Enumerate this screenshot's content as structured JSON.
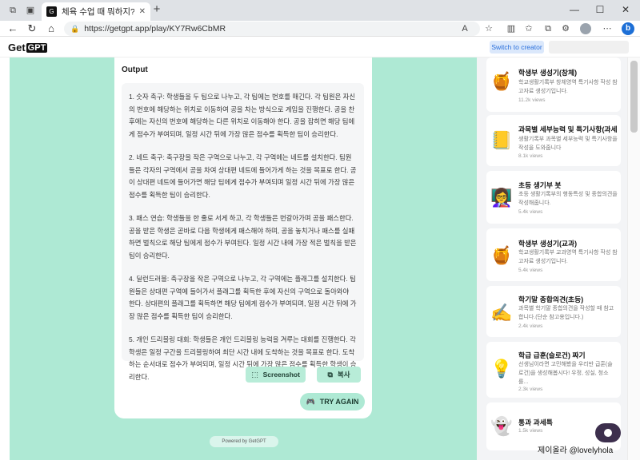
{
  "browser": {
    "tab_title": "체육 수업 때 뭐하지? GetGPT",
    "url": "https://getgpt.app/play/KY7Rw6CbMR"
  },
  "site": {
    "logo_get": "Get",
    "logo_gpt": "GPT",
    "switch_label": "Switch to creator"
  },
  "output": {
    "label": "Output",
    "paragraphs": [
      "1. 숫자 축구: 학생들을 두 팀으로 나누고, 각 팀에는 번호를 매긴다. 각 팀원은 자신의 번호에 해당하는 위치로 이동하여 공을 차는 방식으로 게임을 진행한다. 공을 찬 후에는 자신의 번호에 해당하는 다른 위치로 이동해야 한다. 공을 잡히면 해당 팀에게 점수가 부여되며, 일정 시간 뒤에 가장 많은 점수를 획득한 팀이 승리한다.",
      "2. 네트 축구: 축구장을 작은 구역으로 나누고, 각 구역에는 네트를 설치한다. 팀원들은 각자의 구역에서 공을 차여 상대편 네트에 들어가게 하는 것을 목표로 한다. 공이 상대편 네트에 들어가면 해당 팀에게 점수가 부여되며 일정 시간 뒤에 가장 많은 점수를 획득한 팀이 승리한다.",
      "3. 패스 연습: 학생들을 한 줄로 서게 하고, 각 학생들은 번갈아가며 공을 패스한다. 공을 받은 학생은 곧바로 다음 학생에게 패스해야 하며, 공을 놓치거나 패스를 실패하면 벌칙으로 해당 팀에게 점수가 부여된다. 일정 시간 내에 가장 적은 벌칙을 받은 팀이 승리한다.",
      "4. 딜런드러블: 축구장을 작은 구역으로 나누고, 각 구역에는 플래그를 설치한다. 팀원들은 상대편 구역에 들어가서 플래그를 획득한 후에 자신의 구역으로 돌아와야 한다. 상대편의 플래그를 획득하면 해당 팀에게 점수가 부여되며, 일정 시간 뒤에 가장 많은 점수를 획득한 팀이 승리한다.",
      "5. 개인 드리블링 대회: 학생들은 개인 드리블링 능력을 겨루는 대회를 진행한다. 각 학생은 일정 구간을 드리블링하여 최단 시간 내에 도착하는 것을 목표로 한다. 도착하는 순서대로 점수가 부여되며, 일정 시간 뒤에 가장 많은 점수를 획득한 학생이 승리한다."
    ],
    "screenshot_label": "Screenshot",
    "copy_label": "복사",
    "try_again_label": "TRY AGAIN",
    "powered_label": "Powered by GetGPT"
  },
  "sidebar": {
    "items": [
      {
        "icon": "honey-pot-icon",
        "title": "학생부 생성기(창체)",
        "desc": "학교생활기록부 창체영역 특기사항 작성 참고자료 생성기입니다.",
        "views": "11.2k views"
      },
      {
        "icon": "notebook-icon",
        "title": "과목별 세부능력 및 특기사항(과세...",
        "desc": "생활기록부 과목별 세부능력 및 특기사항을 작성을 도와줍니다",
        "views": "8.1k views"
      },
      {
        "icon": "teacher-icon",
        "title": "초등 생기부 봇",
        "desc": "초등 생활기록부의 행동특성 및 종합의견을 작성해줍니다.",
        "views": "5.4k views"
      },
      {
        "icon": "honey-pot-icon",
        "title": "학생부 생성기(교과)",
        "desc": "학교생활기록부 교과영역 특기사항 작성 참고자료 생성기입니다.",
        "views": "5.4k views"
      },
      {
        "icon": "writing-hand-icon",
        "title": "학기말 종합의견(초등)",
        "desc": "과목별 학기말 종합의견을 작성할 때 참고합니다.(단순 참고용입니다.)",
        "views": "2.4k views"
      },
      {
        "icon": "lightbulb-icon",
        "title": "학급 급훈(슬로건) 짜기",
        "desc": "선생님이라면 고민해봤을 우리반 급훈(슬로건)을 생성해봅시다! 우정, 성실, 청소를...",
        "views": "2.3k views"
      },
      {
        "icon": "ghost-icon",
        "title": "통과 과세특",
        "desc": "",
        "views": "1.5k views"
      }
    ]
  },
  "watermark": "제이올라 @lovelyhola"
}
